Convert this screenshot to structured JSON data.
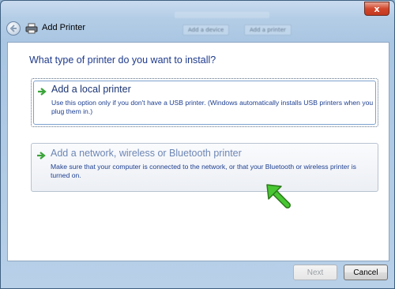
{
  "window": {
    "title": "Add Printer",
    "close_glyph": "x"
  },
  "background_window": {
    "buttons": [
      "Add a device",
      "Add a printer"
    ]
  },
  "main": {
    "question": "What type of printer do you want to install?",
    "options": [
      {
        "title": "Add a local printer",
        "description": "Use this option only if you don't have a USB printer. (Windows automatically installs USB printers when you plug them in.)"
      },
      {
        "title": "Add a network, wireless or Bluetooth printer",
        "description": "Make sure that your computer is connected to the network, or that your Bluetooth or wireless printer is turned on."
      }
    ]
  },
  "footer": {
    "next_label": "Next",
    "cancel_label": "Cancel"
  },
  "icons": {
    "back": "back-arrow-icon",
    "printer": "printer-icon",
    "option_arrow": "green-arrow-icon",
    "pointer": "green-pointer-arrow-icon"
  },
  "colors": {
    "accent_text": "#1e3a8c",
    "option_arrow": "#3aa33a",
    "pointer_arrow": "#3fbf2a"
  }
}
